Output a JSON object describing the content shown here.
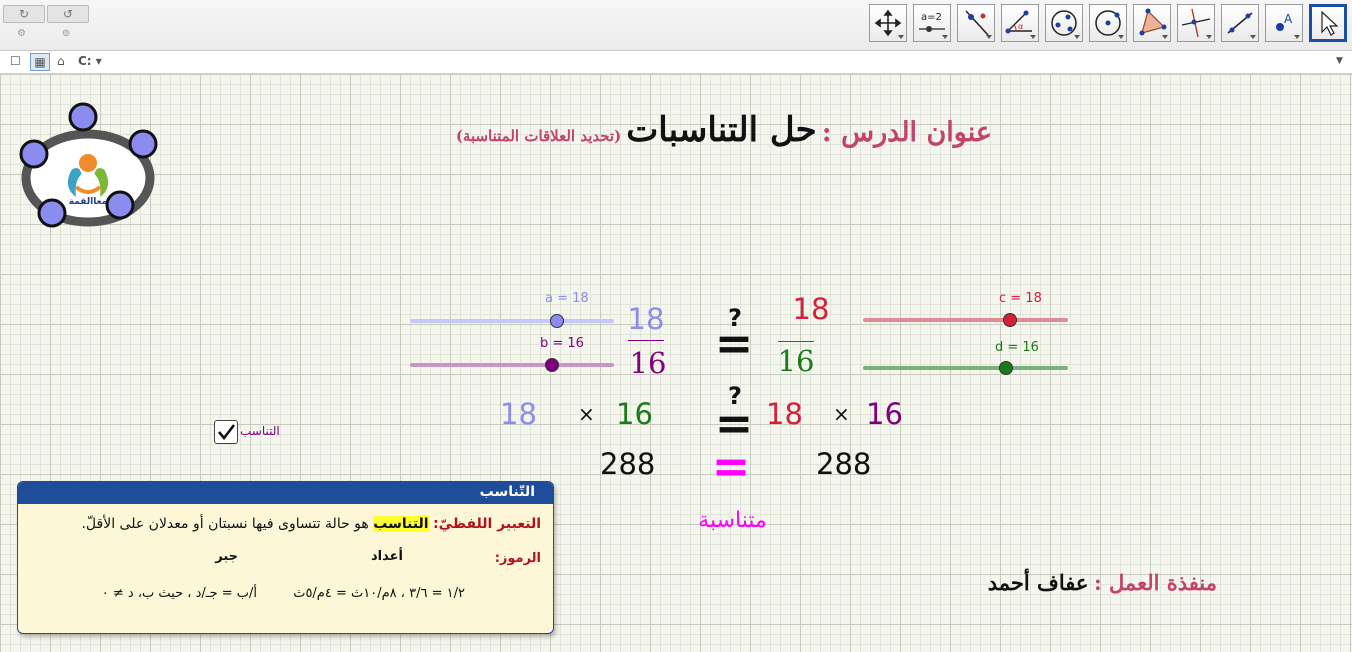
{
  "toolbar": {
    "undo_icon": "undo-icon",
    "redo_icon": "redo-icon",
    "settings_icon": "gear-icon",
    "help_icon": "help-icon",
    "tools": [
      "move-tool",
      "slider-tool",
      "line-tool",
      "angle-tool",
      "circle-tool",
      "circle-center-tool",
      "polygon-tool",
      "perpendicular-tool",
      "segment-tool",
      "point-tool",
      "pointer-tool"
    ],
    "tool_slider_label": "a=2"
  },
  "subbar": {
    "drive_label": "C:"
  },
  "header": {
    "title_label": "عنوان الدرس :",
    "title_main": "حل التناسبات",
    "title_sub": "(تحديد العلاقات المتناسبة)"
  },
  "logo": {
    "text": "معاالقمة"
  },
  "sliders": {
    "a": {
      "label": "a = 18",
      "value": 18,
      "color": "#8c8cf0"
    },
    "b": {
      "label": "b = 16",
      "value": 16,
      "color": "#800080"
    },
    "c": {
      "label": "c = 18",
      "value": 18,
      "color": "#d6203a"
    },
    "d": {
      "label": "d = 16",
      "value": 16,
      "color": "#1b7a1b"
    }
  },
  "fractions": {
    "left_num": "18",
    "left_den": "16",
    "right_num": "18",
    "right_den": "16",
    "question": "?",
    "equals": "="
  },
  "cross": {
    "left_a": "18",
    "left_times": "×",
    "left_b": "16",
    "right_a": "18",
    "right_times": "×",
    "right_b": "16",
    "question": "?",
    "left_result": "288",
    "right_result": "288",
    "equals": "=",
    "verdict": "متناسبة"
  },
  "checkbox": {
    "label": "التناسب",
    "checked": true
  },
  "info": {
    "header": "التّناسب",
    "term": "التعبير اللفظيّ:",
    "highlight": "التناسب",
    "definition": "هو حالة تتساوى فيها نسبتان أو معدلان على الأقلّ.",
    "symbols_label": "الرموز:",
    "numbers_label": "أعداد",
    "algebra_label": "جبر",
    "numbers_example": "١/٢ = ٣/٦ ، ٨م/١٠ث = ٤م/٥ث",
    "algebra_example": "أ/ب = جـ/د ، حيث ب، د ≠ ٠"
  },
  "author": {
    "label": "منفذة العمل :",
    "name": "عفاف أحمد"
  },
  "colors": {
    "title_pink": "#c2436c",
    "dark": "#111111",
    "magenta": "#ff00ff",
    "info_blue": "#1f4d99",
    "info_red": "#b0131b",
    "highlight_yellow": "#ffff33"
  }
}
